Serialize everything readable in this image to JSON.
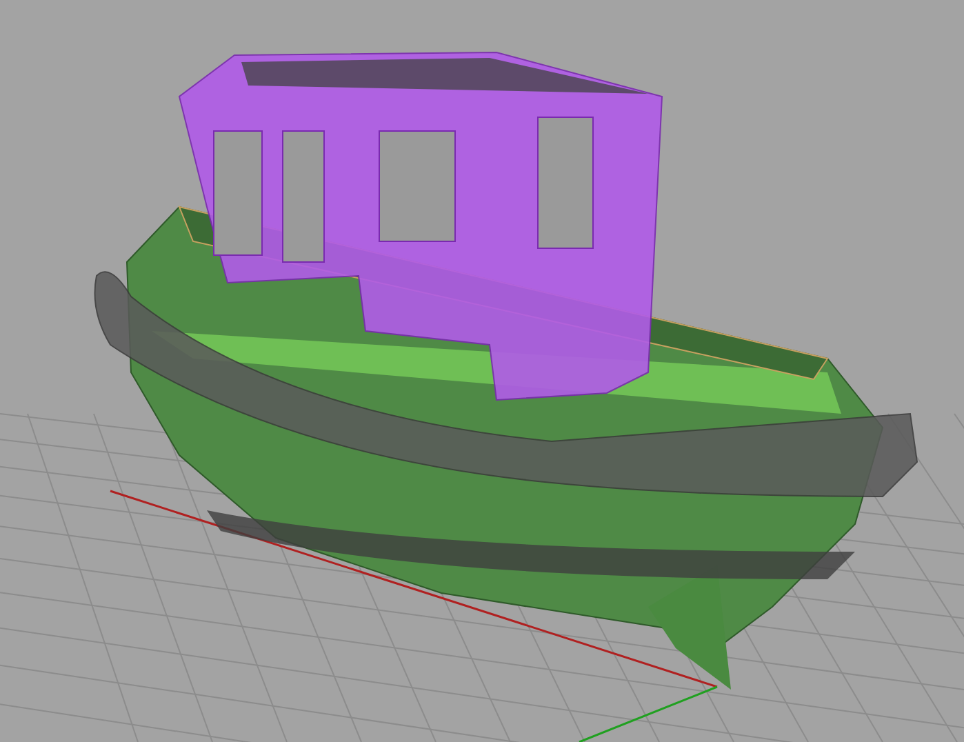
{
  "viewport": {
    "objects": [
      {
        "kind": "hull"
      },
      {
        "kind": "fender"
      },
      {
        "kind": "cabin"
      }
    ]
  }
}
